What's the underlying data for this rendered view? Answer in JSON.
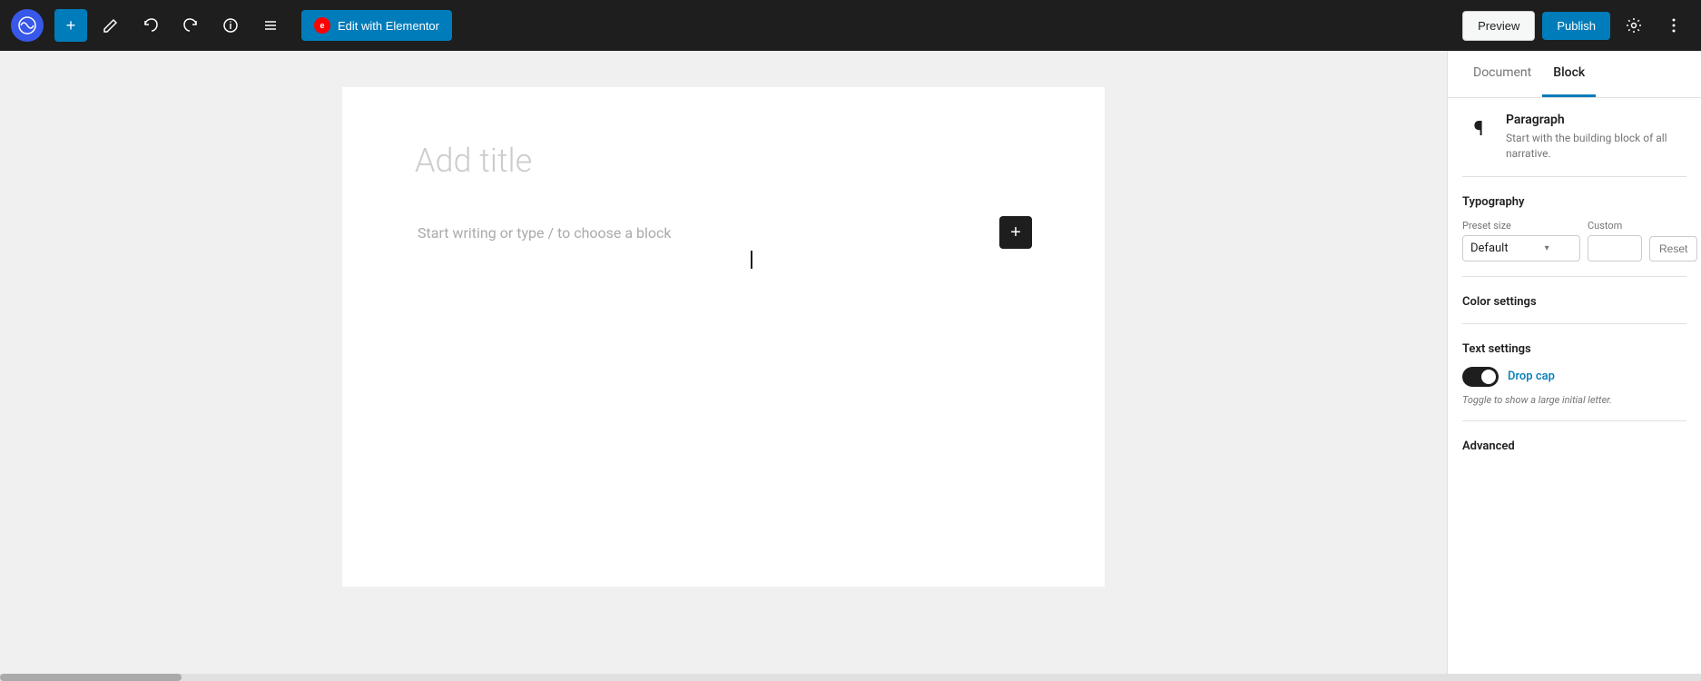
{
  "toolbar": {
    "add_label": "+",
    "undo_label": "↩",
    "redo_label": "↪",
    "info_label": "ℹ",
    "list_label": "≡",
    "elementor_btn": "Edit with Elementor",
    "preview_label": "Preview",
    "publish_label": "Publish",
    "settings_icon": "⚙",
    "more_icon": "⋮"
  },
  "editor": {
    "title_placeholder": "Add title",
    "block_placeholder": "Start writing or type / to choose a block"
  },
  "sidebar": {
    "tab_document": "Document",
    "tab_block": "Block",
    "block_name": "Paragraph",
    "block_desc": "Start with the building block of all narrative.",
    "typography_label": "Typography",
    "preset_size_label": "Preset size",
    "preset_default": "Default",
    "custom_label": "Custom",
    "reset_label": "Reset",
    "color_settings_label": "Color settings",
    "text_settings_label": "Text settings",
    "drop_cap_label": "Drop cap",
    "drop_cap_desc": "Toggle to show a large initial letter.",
    "advanced_label": "Advanced"
  }
}
